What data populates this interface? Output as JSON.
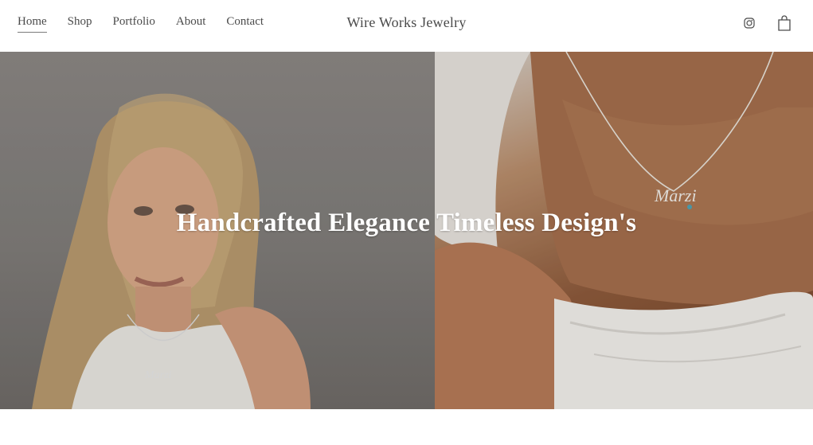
{
  "header": {
    "nav": [
      {
        "label": "Home",
        "active": true
      },
      {
        "label": "Shop",
        "active": false
      },
      {
        "label": "Portfolio",
        "active": false
      },
      {
        "label": "About",
        "active": false
      },
      {
        "label": "Contact",
        "active": false
      }
    ],
    "brand": "Wire Works Jewelry",
    "icons": [
      "instagram-icon",
      "shopping-bag-icon"
    ]
  },
  "hero": {
    "title": "Handcrafted Elegance Timeless Design's",
    "necklace_text": "Marzi",
    "colors": {
      "left_bg": "#7f7c79",
      "right_bg": "#8d5a3b",
      "text": "#ffffff"
    }
  }
}
